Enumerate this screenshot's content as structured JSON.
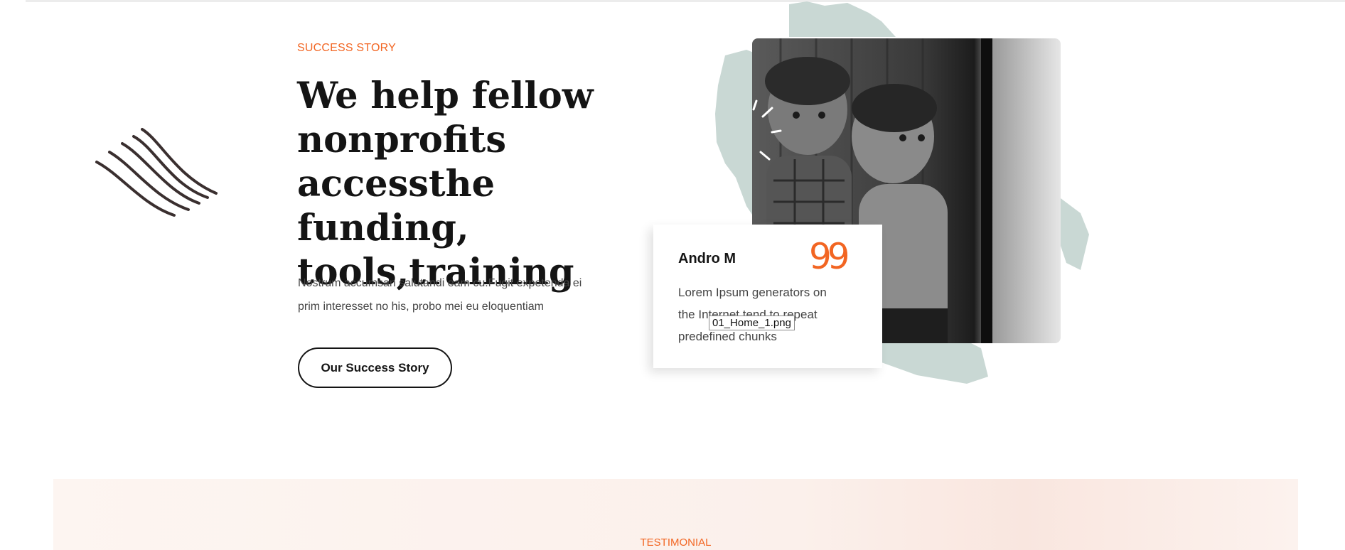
{
  "success": {
    "eyebrow": "SUCCESS STORY",
    "headline": "We help fellow nonprofits accessthe funding, tools,training",
    "lead": "Nostrum accumsan salutandi eam cu.Fugit expetenda ei prim interesset no his, probo mei eu eloquentiam",
    "button_label": "Our Success Story"
  },
  "quote_card": {
    "name": "Andro M",
    "quote_mark": "99",
    "text": "Lorem Ipsum generators on the Internet tend to repeat predefined chunks"
  },
  "image": {
    "alt_tooltip": "01_Home_1.png"
  },
  "testimonial": {
    "eyebrow": "TESTIMONIAL"
  },
  "colors": {
    "accent": "#f26522",
    "heading": "#141414",
    "body_text": "#444444",
    "brush": "#c9d8d4",
    "band": "#fbf0eb"
  },
  "icons": [
    "squiggle-lines-icon",
    "quote-icon"
  ]
}
